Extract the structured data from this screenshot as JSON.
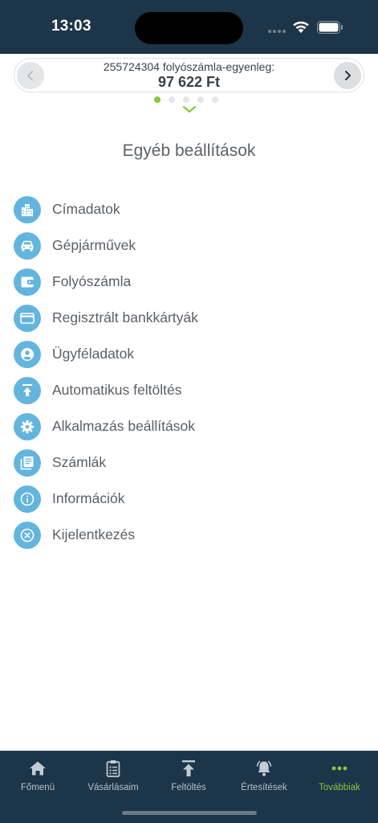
{
  "status_bar": {
    "time": "13:03"
  },
  "balance": {
    "label": "255724304 folyószámla-egyenleg:",
    "amount": "97 622 Ft"
  },
  "pager": {
    "count": 5,
    "active_index": 0
  },
  "section_title": "Egyéb beállítások",
  "menu": [
    {
      "label": "Címadatok",
      "icon": "building-icon"
    },
    {
      "label": "Gépjárművek",
      "icon": "car-icon"
    },
    {
      "label": "Folyószámla",
      "icon": "wallet-icon"
    },
    {
      "label": "Regisztrált bankkártyák",
      "icon": "credit-card-icon"
    },
    {
      "label": "Ügyféladatok",
      "icon": "user-circle-icon"
    },
    {
      "label": "Automatikus feltöltés",
      "icon": "upload-icon"
    },
    {
      "label": "Alkalmazás beállítások",
      "icon": "gear-icon"
    },
    {
      "label": "Számlák",
      "icon": "invoices-icon"
    },
    {
      "label": "Információk",
      "icon": "info-icon"
    },
    {
      "label": "Kijelentkezés",
      "icon": "logout-icon"
    }
  ],
  "tabs": [
    {
      "label": "Főmenü",
      "icon": "home-icon",
      "active": false
    },
    {
      "label": "Vásárlásaim",
      "icon": "clipboard-icon",
      "active": false
    },
    {
      "label": "Feltöltés",
      "icon": "upload-icon",
      "active": false
    },
    {
      "label": "Értesítések",
      "icon": "bell-icon",
      "active": false
    },
    {
      "label": "Továbbiak",
      "icon": "more-icon",
      "active": true
    }
  ],
  "colors": {
    "header_bg": "#1d3549",
    "icon_circle": "#64b5dd",
    "accent_green": "#8cc63f"
  }
}
